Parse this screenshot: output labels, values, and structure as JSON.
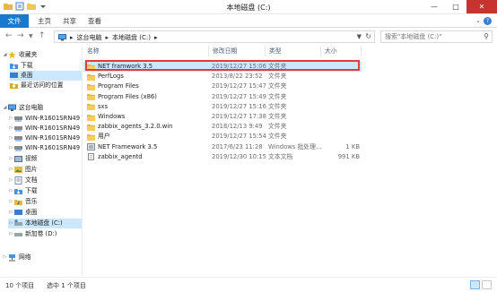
{
  "window": {
    "title": "本地磁盘 (C:)"
  },
  "ribbon": {
    "tabs": [
      "文件",
      "主页",
      "共享",
      "查看"
    ]
  },
  "address": {
    "crumbs": [
      "这台电脑",
      "本地磁盘 (C:)"
    ],
    "search_placeholder": "搜索\"本地磁盘 (C:)\""
  },
  "nav": {
    "favorites": "收藏夹",
    "favorite_items": [
      "下载",
      "桌面",
      "最近访问的位置"
    ],
    "this_pc": "这台电脑",
    "pc_items": [
      "WIN-R1601SRN49",
      "WIN-R1601SRN49",
      "WIN-R1601SRN49",
      "WIN-R1601SRN49",
      "视频",
      "图片",
      "文档",
      "下载",
      "音乐",
      "桌面",
      "本地磁盘 (C:)",
      "新加卷 (D:)"
    ],
    "network": "网络"
  },
  "columns": {
    "name": "名称",
    "date": "修改日期",
    "type": "类型",
    "size": "大小"
  },
  "files": [
    {
      "name": "NET framwork 3.5",
      "date": "2019/12/27 15:06",
      "type": "文件夹",
      "size": "",
      "icon": "folder-icon"
    },
    {
      "name": "PerfLogs",
      "date": "2013/8/22 23:52",
      "type": "文件夹",
      "size": "",
      "icon": "folder-icon"
    },
    {
      "name": "Program Files",
      "date": "2019/12/27 15:47",
      "type": "文件夹",
      "size": "",
      "icon": "folder-icon"
    },
    {
      "name": "Program Files (x86)",
      "date": "2019/12/27 15:49",
      "type": "文件夹",
      "size": "",
      "icon": "folder-icon"
    },
    {
      "name": "sxs",
      "date": "2019/12/27 15:16",
      "type": "文件夹",
      "size": "",
      "icon": "folder-icon"
    },
    {
      "name": "Windows",
      "date": "2019/12/27 17:38",
      "type": "文件夹",
      "size": "",
      "icon": "folder-icon"
    },
    {
      "name": "zabbix_agents_3.2.0.win",
      "date": "2018/12/13 9:49",
      "type": "文件夹",
      "size": "",
      "icon": "folder-icon"
    },
    {
      "name": "用户",
      "date": "2019/12/27 15:54",
      "type": "文件夹",
      "size": "",
      "icon": "folder-icon"
    },
    {
      "name": "NET Framework 3.5",
      "date": "2017/6/23 11:28",
      "type": "Windows 批处理...",
      "size": "1 KB",
      "icon": "batch-file-icon"
    },
    {
      "name": "zabbix_agentd",
      "date": "2019/12/30 10:15",
      "type": "文本文档",
      "size": "991 KB",
      "icon": "text-file-icon"
    }
  ],
  "status": {
    "count": "10 个项目",
    "selected": "选中 1 个项目"
  }
}
